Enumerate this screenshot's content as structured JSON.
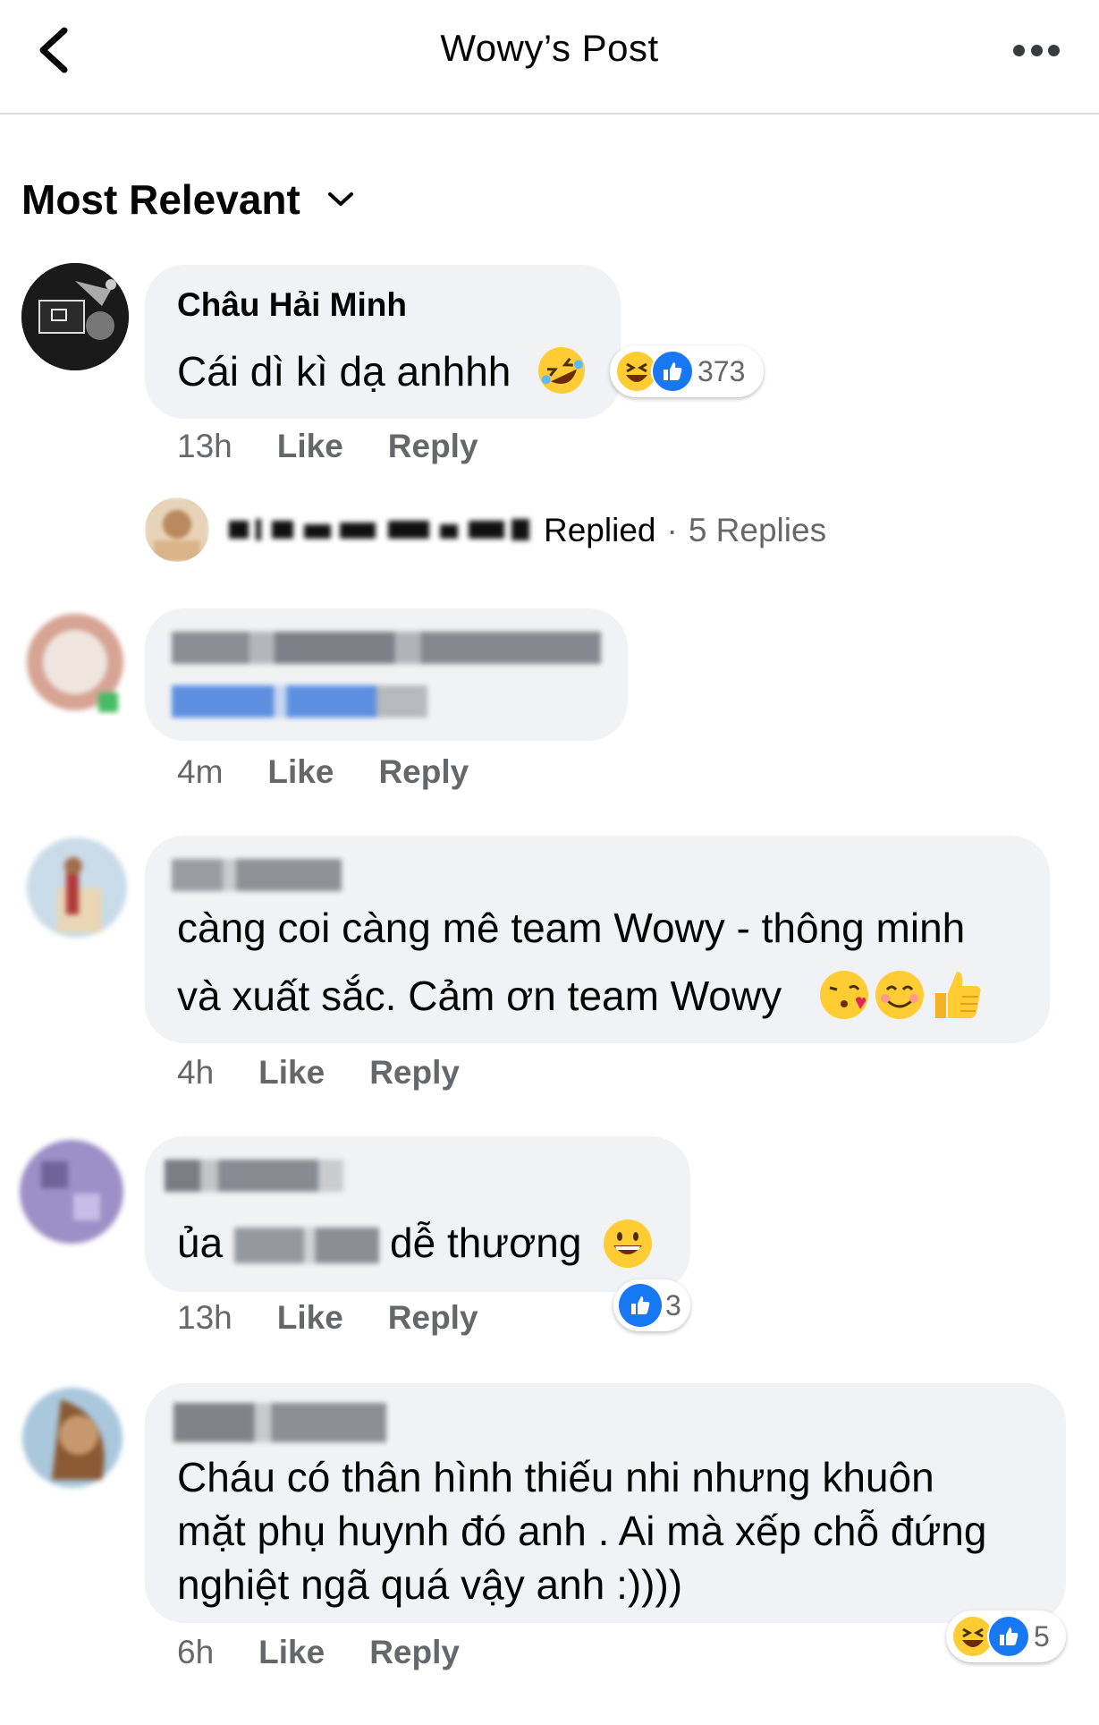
{
  "header": {
    "title": "Wowy’s Post"
  },
  "sort": {
    "label": "Most Relevant"
  },
  "comments": [
    {
      "name": "Châu Hải Minh",
      "text": "Cái dì kì dạ anhhh",
      "time": "13h",
      "like": "Like",
      "reply": "Reply",
      "reaction_count": "373"
    },
    {
      "time": "4m",
      "like": "Like",
      "reply": "Reply"
    },
    {
      "text_line1": "càng coi càng mê team Wowy - thông minh",
      "text_line2": "và xuất sắc. Cảm ơn team Wowy",
      "time": "4h",
      "like": "Like",
      "reply": "Reply"
    },
    {
      "text_pre": "ủa",
      "text_post": "dễ thương",
      "time": "13h",
      "like": "Like",
      "reply": "Reply",
      "reaction_count": "3"
    },
    {
      "text_line1": "Cháu có thân hình thiếu nhi nhưng khuôn",
      "text_line2": "mặt phụ huynh đó anh . Ai mà xếp chỗ đứng",
      "text_line3": "nghiệt ngã quá vậy anh :))))",
      "time": "6h",
      "like": "Like",
      "reply": "Reply",
      "reaction_count": "5"
    }
  ],
  "replies_summary": {
    "replied": "Replied",
    "separator": "·",
    "count": "5 Replies"
  },
  "colors": {
    "like_blue": "#1877f2",
    "meta_gray": "#65676b",
    "bubble_bg": "#f0f2f5",
    "emoji_yellow": "#ffcc33"
  }
}
